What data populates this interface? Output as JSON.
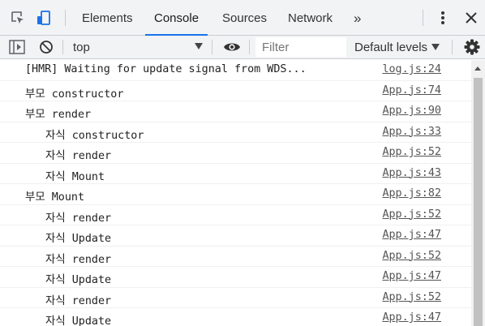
{
  "tabs": [
    {
      "label": "Elements"
    },
    {
      "label": "Console"
    },
    {
      "label": "Sources"
    },
    {
      "label": "Network"
    }
  ],
  "more_tabs_label": "»",
  "toolbar": {
    "context": "top",
    "filter_placeholder": "Filter",
    "levels": "Default levels"
  },
  "messages": [
    {
      "text": "[HMR] Waiting for update signal from WDS...",
      "source": "log.js:24"
    },
    {
      "text": "부모 constructor",
      "source": "App.js:74"
    },
    {
      "text": "부모 render",
      "source": "App.js:90"
    },
    {
      "text": "자식 constructor",
      "source": "App.js:33"
    },
    {
      "text": "자식 render",
      "source": "App.js:52"
    },
    {
      "text": "자식 Mount",
      "source": "App.js:43"
    },
    {
      "text": "부모 Mount",
      "source": "App.js:82"
    },
    {
      "text": "자식 render",
      "source": "App.js:52"
    },
    {
      "text": "자식 Update",
      "source": "App.js:47"
    },
    {
      "text": "자식 render",
      "source": "App.js:52"
    },
    {
      "text": "자식 Update",
      "source": "App.js:47"
    },
    {
      "text": "자식 render",
      "source": "App.js:52"
    },
    {
      "text": "자식 Update",
      "source": "App.js:47"
    }
  ],
  "colors": {
    "active_tab_underline": "#1a73e8",
    "toolbar_bg": "#f1f3f4"
  }
}
